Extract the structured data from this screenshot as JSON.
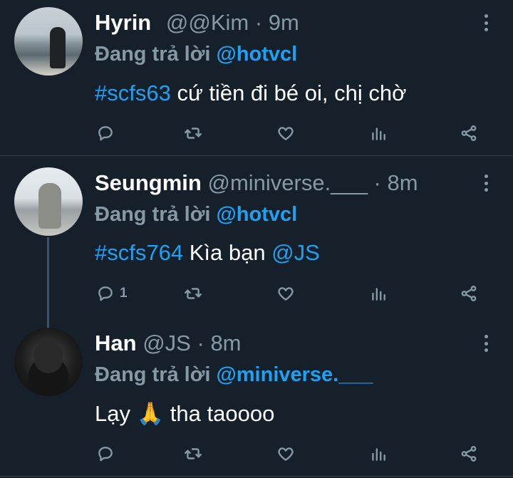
{
  "tweets": [
    {
      "name": "Hyrin",
      "handle": "@@Kim",
      "dot": "·",
      "time": "9m",
      "reply_prefix": "Đang trả lời",
      "reply_mention": "@hotvcl",
      "hashtag": "#scfs63",
      "text": " cứ tiền đi bé oi, chị chờ",
      "reply_count": ""
    },
    {
      "name": "Seungmin",
      "handle": "@miniverse.___",
      "dot": "·",
      "time": "8m",
      "reply_prefix": "Đang trả lời",
      "reply_mention": "@hotvcl",
      "hashtag": "#scfs764",
      "text": " Kìa bạn ",
      "text_mention": "@JS",
      "reply_count": "1"
    },
    {
      "name": "Han",
      "handle": "@JS",
      "dot": "·",
      "time": "8m",
      "reply_prefix": "Đang trả lời",
      "reply_mention": "@miniverse.___",
      "text": "Lạy 🙏 tha taoooo",
      "reply_count": ""
    }
  ],
  "icons": [
    "reply-icon",
    "retweet-icon",
    "like-icon",
    "analytics-icon",
    "share-icon",
    "more-icon"
  ],
  "colors": {
    "background": "#15202b",
    "accent": "#1da1f2",
    "muted": "#8899a6",
    "divider": "#38444d"
  }
}
